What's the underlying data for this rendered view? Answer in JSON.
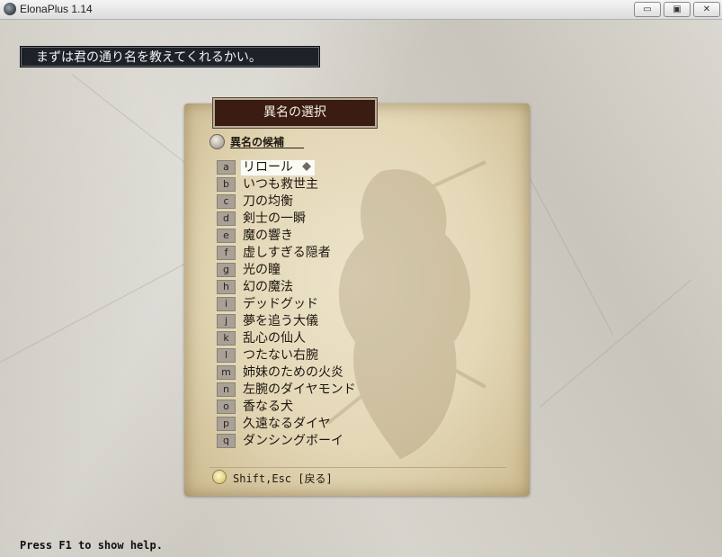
{
  "window": {
    "title": "ElonaPlus 1.14",
    "minimize": "▭",
    "maximize": "▣",
    "close": "✕"
  },
  "prompt": {
    "text": "まずは君の通り名を教えてくれるかい。"
  },
  "dialog": {
    "header": "異名の選択",
    "section_title": "異名の候補",
    "items": [
      {
        "key": "a",
        "label": "リロール"
      },
      {
        "key": "b",
        "label": "いつも救世主"
      },
      {
        "key": "c",
        "label": "刀の均衡"
      },
      {
        "key": "d",
        "label": "剣士の一瞬"
      },
      {
        "key": "e",
        "label": "魔の響き"
      },
      {
        "key": "f",
        "label": "虚しすぎる隠者"
      },
      {
        "key": "g",
        "label": "光の瞳"
      },
      {
        "key": "h",
        "label": "幻の魔法"
      },
      {
        "key": "i",
        "label": "デッドグッド"
      },
      {
        "key": "j",
        "label": "夢を追う大儀"
      },
      {
        "key": "k",
        "label": "乱心の仙人"
      },
      {
        "key": "l",
        "label": "つたない右腕"
      },
      {
        "key": "m",
        "label": "姉妹のための火炎"
      },
      {
        "key": "n",
        "label": "左腕のダイヤモンド"
      },
      {
        "key": "o",
        "label": "香なる犬"
      },
      {
        "key": "p",
        "label": "久遠なるダイヤ"
      },
      {
        "key": "q",
        "label": "ダンシングボーイ"
      }
    ],
    "selected_key": "a",
    "hint": "Shift,Esc [戻る]"
  },
  "help": {
    "text": "Press F1 to show help."
  },
  "icons": {
    "app": "elona-app-icon",
    "section": "circle-marker-icon",
    "cursor": "diamond-cursor-icon",
    "hint": "lightbulb-icon"
  },
  "colors": {
    "prompt_bg": "#1c2228",
    "header_bg": "#3a1c12",
    "parchment": "#e3d7b6",
    "key_box": "#a9a196"
  }
}
